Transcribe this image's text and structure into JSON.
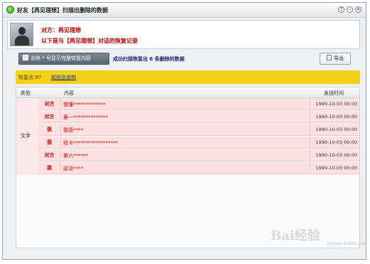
{
  "window": {
    "title": "好友【再见理想】扫描出删除的数据",
    "buttons": {
      "help": "?",
      "minimize": "–",
      "close": "×"
    }
  },
  "header": {
    "contact_line": "对方：再见理想",
    "description": "以下是与【再见理想】对话的恢复记录"
  },
  "toolbar": {
    "clean_button_label": "去除 * 号显示完整恢复内容",
    "scan_status": "成功扫描恢复出 6 条删除的数据",
    "export_button_label": "导出"
  },
  "summary": {
    "recovered_count": "恢复点:97",
    "rules_link": "规则及说明"
  },
  "table": {
    "columns": [
      "类型",
      "内容",
      "发送时间"
    ],
    "type_label": "文字",
    "rows": [
      {
        "sender": "对方",
        "content": "我懂*************",
        "time": "1990-10-03 00:00"
      },
      {
        "sender": "对方",
        "content": "第一**************",
        "time": "1990-10-03 00:00"
      },
      {
        "sender": "我",
        "content": "我感****",
        "time": "1990-10-03 00:00"
      },
      {
        "sender": "我",
        "content": "纽卡******************",
        "time": "1990-10-03 00:00"
      },
      {
        "sender": "对方",
        "content": "第六******",
        "time": "1990-10-03 00:00"
      },
      {
        "sender": "我",
        "content": "这没****",
        "time": "1990-10-03 00:00"
      }
    ]
  },
  "watermark": {
    "brand": "Bai经验",
    "url": "jingyan.baidu.com"
  },
  "colors": {
    "accent_red": "#c00000",
    "highlight_yellow": "#f5d21a",
    "row_pink": "#fde0e0"
  }
}
